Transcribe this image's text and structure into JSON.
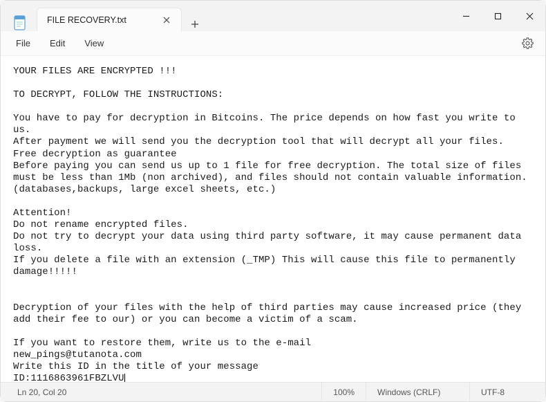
{
  "titlebar": {
    "tab_title": "FILE RECOVERY.txt"
  },
  "menu": {
    "file": "File",
    "edit": "Edit",
    "view": "View"
  },
  "content": {
    "text": "YOUR FILES ARE ENCRYPTED !!!\n\nTO DECRYPT, FOLLOW THE INSTRUCTIONS:\n\nYou have to pay for decryption in Bitcoins. The price depends on how fast you write to us.\nAfter payment we will send you the decryption tool that will decrypt all your files.\nFree decryption as guarantee\nBefore paying you can send us up to 1 file for free decryption. The total size of files must be less than 1Mb (non archived), and files should not contain valuable information. (databases,backups, large excel sheets, etc.)\n\nAttention!\nDo not rename encrypted files.\nDo not try to decrypt your data using third party software, it may cause permanent data loss.\nIf you delete a file with an extension (_TMP) This will cause this file to permanently damage!!!!!\n\n\nDecryption of your files with the help of third parties may cause increased price (they add their fee to our) or you can become a victim of a scam.\n\nIf you want to restore them, write us to the e-mail\nnew_pings@tutanota.com\nWrite this ID in the title of your message\nID:1116863961FBZLVU"
  },
  "status": {
    "position": "Ln 20, Col 20",
    "zoom": "100%",
    "line_ending": "Windows (CRLF)",
    "encoding": "UTF-8"
  }
}
